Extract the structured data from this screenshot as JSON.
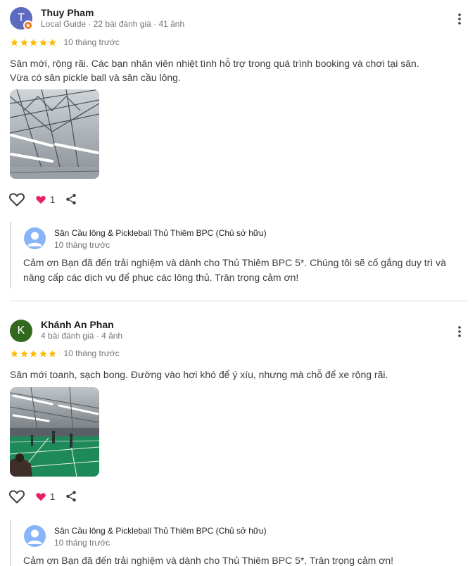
{
  "reviews": [
    {
      "avatar_letter": "T",
      "avatar_color": "#5c6bc0",
      "name": "Thuy Pham",
      "meta": "Local Guide · 22 bài đánh giá · 41 ảnh",
      "rating": 5,
      "date": "10 tháng trước",
      "text_lines": [
        "Sân mới, rộng rãi. Các bạn nhân viên nhiệt tình hỗ trợ trong quá trình booking và chơi tại sân.",
        "Vừa có sân pickle ball và sân cầu lông."
      ],
      "like_count": "1",
      "reply": {
        "owner_name": "Sân Cầu lông & Pickleball Thủ Thiêm BPC (Chủ sở hữu)",
        "date": "10 tháng trước",
        "text_lines": [
          "Cảm ơn Bạn đã đến trải nghiệm và dành cho Thủ Thiêm BPC 5*. Chúng tôi sẽ cố gắng duy trì và",
          "nâng cấp các dịch vụ để phục các lông thủ. Trân trọng cảm ơn!"
        ]
      }
    },
    {
      "avatar_letter": "K",
      "avatar_color": "#33691e",
      "name": "Khánh An Phan",
      "meta": "4 bài đánh giá · 4 ảnh",
      "rating": 5,
      "date": "10 tháng trước",
      "text_lines": [
        "Sân mới toanh, sạch bong. Đường vào hơi khó để ý xíu, nhưng mà chỗ để xe rộng rãi."
      ],
      "like_count": "1",
      "reply": {
        "owner_name": "Sân Cầu lông & Pickleball Thủ Thiêm BPC (Chủ sở hữu)",
        "date": "10 tháng trước",
        "text_lines": [
          "Cảm ơn Bạn đã đến trải nghiệm và dành cho Thủ Thiêm BPC 5*. Trân trọng cảm ơn!"
        ]
      }
    }
  ],
  "colors": {
    "star": "#fbbc04",
    "heart_filled": "#e91e63",
    "muted_text": "#70757a"
  },
  "icons": [
    "more-vert-icon",
    "heart-outline-icon",
    "heart-filled-icon",
    "share-icon",
    "star-icon",
    "local-guide-badge-icon"
  ]
}
